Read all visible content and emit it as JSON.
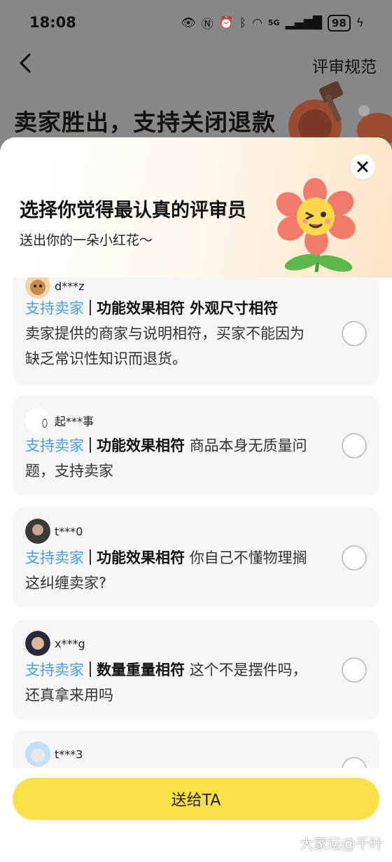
{
  "status_bar": {
    "time": "18:08",
    "network": "5G",
    "battery": "98"
  },
  "background_page": {
    "rules_link": "评审规范",
    "title": "卖家胜出，支持关闭退款"
  },
  "sheet": {
    "title": "选择你觉得最认真的评审员",
    "subtitle": "送出你的一朵小红花～",
    "close_icon": "close-icon"
  },
  "reviews": [
    {
      "user": "d***z",
      "support": "支持卖家",
      "tags": "功能效果相符 外观尺寸相符",
      "text": "卖家提供的商家与说明相符，买家不能因为缺乏常识性知识而退货。"
    },
    {
      "user": "起***事",
      "support": "支持卖家",
      "tags": "功能效果相符",
      "text": "商品本身无质量问题，支持卖家"
    },
    {
      "user": "t***0",
      "support": "支持卖家",
      "tags": "功能效果相符",
      "text": "你自己不懂物理搁这纠缠卖家?"
    },
    {
      "user": "x***g",
      "support": "支持卖家",
      "tags": "数量重量相符",
      "text": "这个不是摆件吗，还真拿来用吗"
    },
    {
      "user": "t***3"
    }
  ],
  "footer": {
    "submit_label": "送给TA"
  },
  "watermark": "大家坛@千叶",
  "colors": {
    "accent_blue": "#4a9fe0",
    "button_yellow": "#fbe04a"
  }
}
